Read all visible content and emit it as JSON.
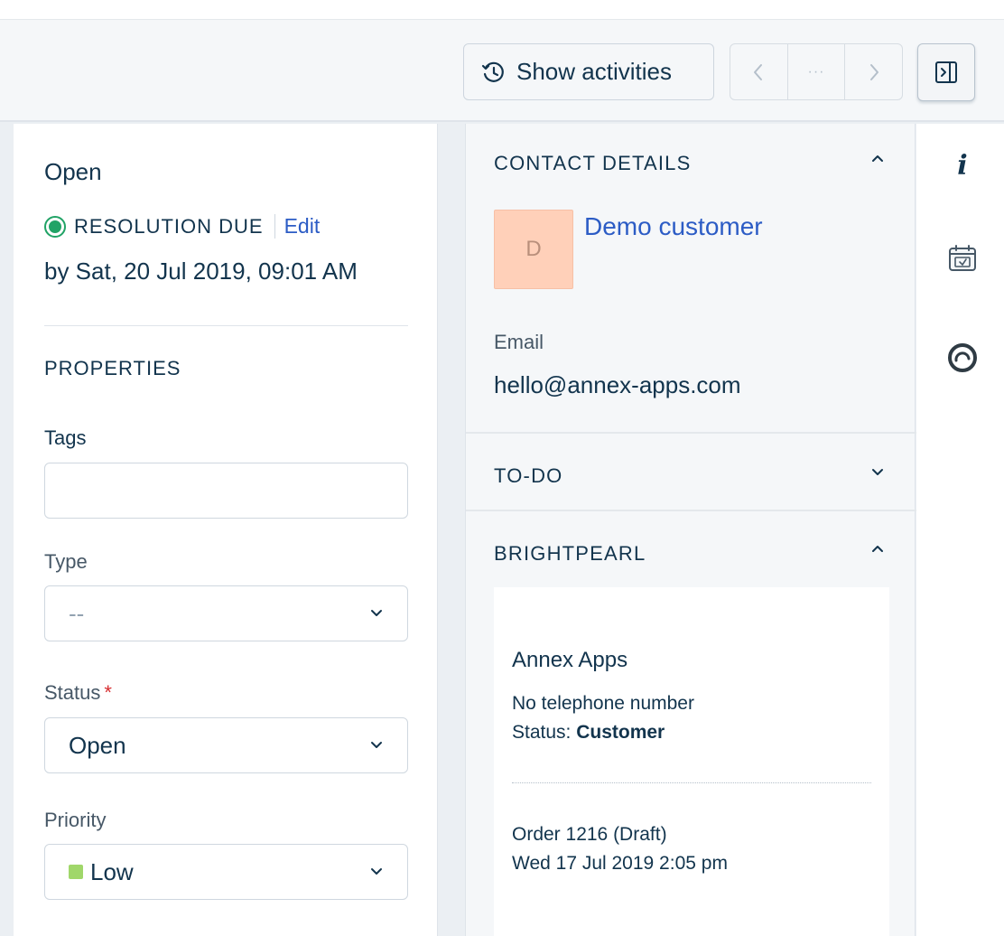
{
  "toolbar": {
    "show_activities_label": "Show activities",
    "pager_more": "···"
  },
  "ticket": {
    "state": "Open",
    "resolution_label": "RESOLUTION DUE",
    "edit_label": "Edit",
    "due_text": "by Sat, 20 Jul 2019, 09:01 AM",
    "status_color": "#21a366"
  },
  "properties": {
    "heading": "PROPERTIES",
    "tags_label": "Tags",
    "tags_value": "",
    "type_label": "Type",
    "type_value": "--",
    "status_label": "Status",
    "status_required": "*",
    "status_value": "Open",
    "priority_label": "Priority",
    "priority_value": "Low",
    "priority_color": "#a0d76a"
  },
  "contact": {
    "heading": "CONTACT DETAILS",
    "avatar_initial": "D",
    "avatar_color": "#ffd0b9",
    "name": "Demo customer",
    "email_label": "Email",
    "email": "hello@annex-apps.com"
  },
  "todo": {
    "heading": "TO-DO"
  },
  "brightpearl": {
    "heading": "BRIGHTPEARL",
    "company": "Annex Apps",
    "phone": "No telephone number",
    "status_label": "Status: ",
    "status_value": "Customer",
    "order": "Order 1216 (Draft)",
    "order_date": "Wed 17 Jul 2019 2:05 pm"
  },
  "rail": {
    "icons": [
      "info-icon",
      "calendar-icon",
      "brightpearl-icon"
    ]
  }
}
